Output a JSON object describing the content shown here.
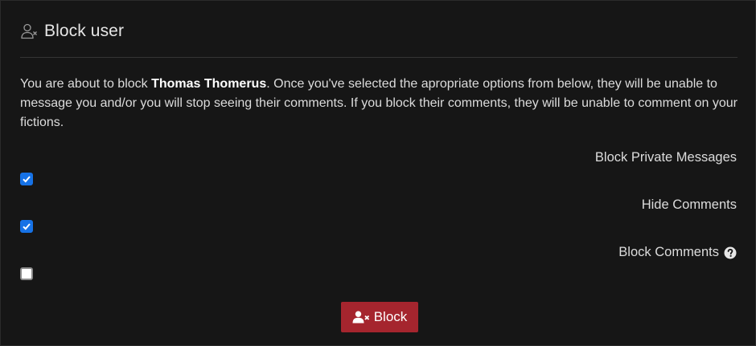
{
  "modal": {
    "title": "Block user",
    "title_icon": "user-times-icon",
    "description": {
      "prefix": "You are about to block ",
      "username": "Thomas Thomerus",
      "suffix": ". Once you've selected the apropriate options from below, they will be unable to message you and/or you will stop seeing their comments. If you block their comments, they will be unable to comment on your fictions."
    },
    "options": [
      {
        "label": "Block Private Messages",
        "checked": true
      },
      {
        "label": "Hide Comments",
        "checked": true
      },
      {
        "label": "Block Comments",
        "checked": false,
        "help_icon": "question-circle-icon"
      }
    ],
    "block_button": {
      "label": "Block",
      "icon": "user-times-icon"
    }
  },
  "colors": {
    "background": "#161616",
    "button": "#a5252e",
    "checkbox_checked": "#1672e6",
    "text": "#dcdcdc"
  }
}
